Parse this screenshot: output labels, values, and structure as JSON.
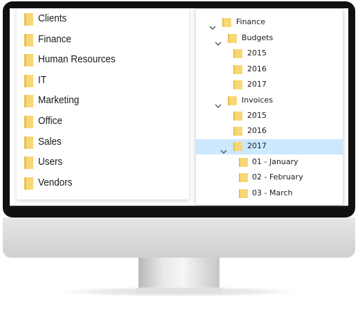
{
  "left_panel": {
    "items": [
      {
        "label": "Clients"
      },
      {
        "label": "Finance"
      },
      {
        "label": "Human Resources"
      },
      {
        "label": "IT"
      },
      {
        "label": "Marketing"
      },
      {
        "label": "Office"
      },
      {
        "label": "Sales"
      },
      {
        "label": "Users"
      },
      {
        "label": "Vendors"
      }
    ]
  },
  "tree": {
    "nodes": [
      {
        "label": "Finance",
        "expanded": true
      },
      {
        "label": "Budgets",
        "expanded": true
      },
      {
        "label": "2015"
      },
      {
        "label": "2016"
      },
      {
        "label": "2017"
      },
      {
        "label": "Invoices",
        "expanded": true
      },
      {
        "label": "2015"
      },
      {
        "label": "2016"
      },
      {
        "label": "2017",
        "expanded": true,
        "selected": true
      },
      {
        "label": "01 - January"
      },
      {
        "label": "02 - February"
      },
      {
        "label": "03 - March"
      }
    ]
  },
  "colors": {
    "folder": "#f8d775",
    "folder_dark": "#e6b84a",
    "selection": "#cce8ff",
    "bezel": "#101010"
  },
  "icons": {
    "folder": "folder-icon",
    "expand": "chevron-down-icon"
  }
}
